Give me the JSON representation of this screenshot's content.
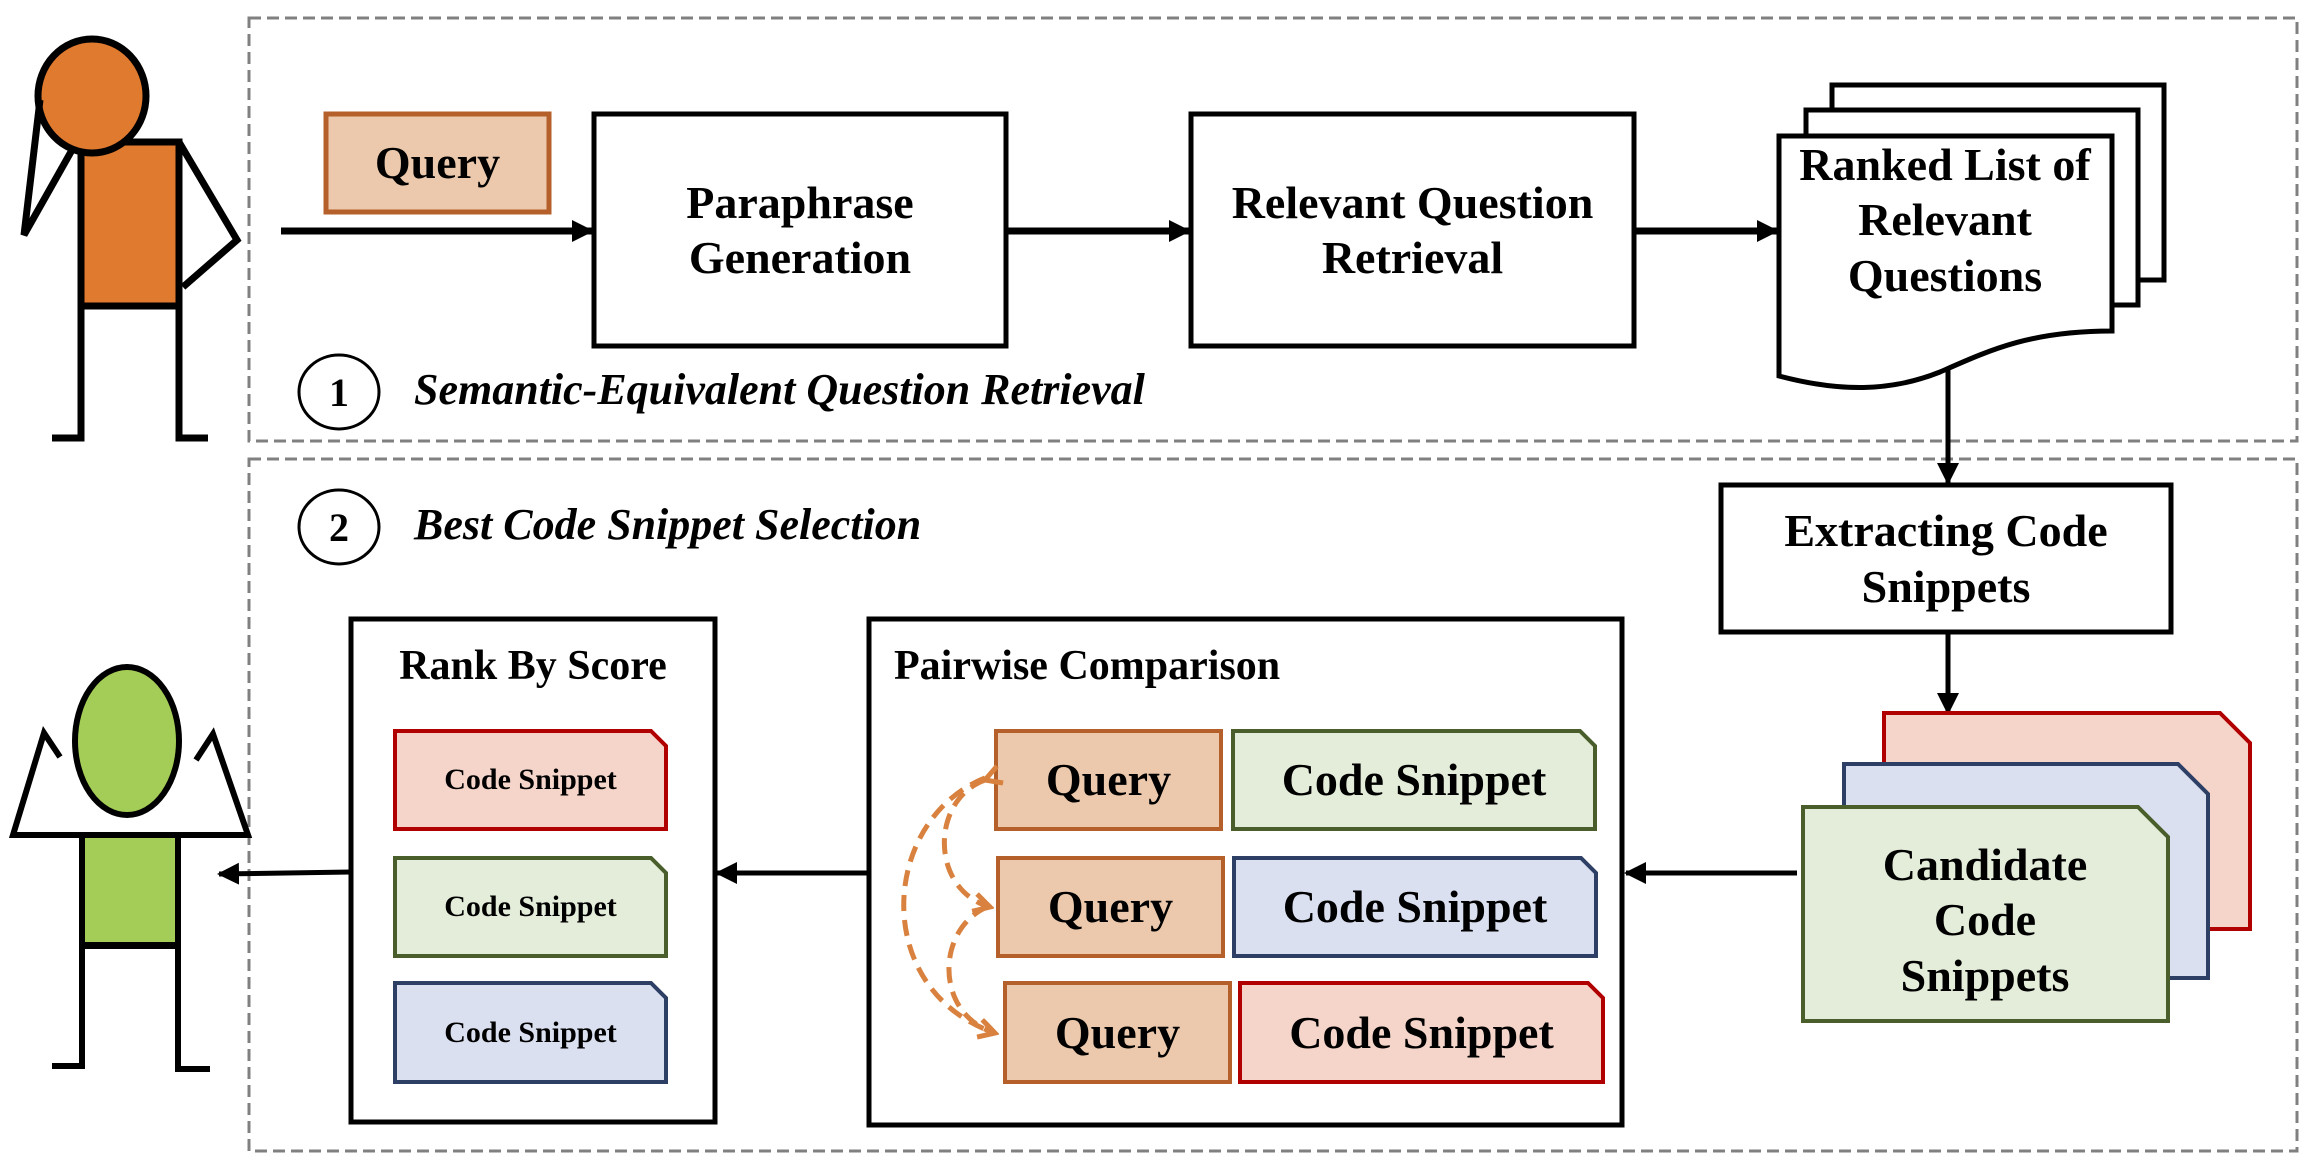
{
  "stages": {
    "stage1": {
      "number": "1",
      "title": "Semantic-Equivalent Question Retrieval"
    },
    "stage2": {
      "number": "2",
      "title": "Best Code Snippet Selection"
    }
  },
  "nodes": {
    "query": "Query",
    "paraphrase": "Paraphrase Generation",
    "relevant_retrieval": "Relevant Question Retrieval",
    "ranked_list": "Ranked List of Relevant Questions",
    "extracting": "Extracting Code Snippets",
    "candidates": "Candidate Code Snippets",
    "pairwise_title": "Pairwise Comparison",
    "rank_title": "Rank By Score"
  },
  "pairwise_rows": [
    {
      "query": "Query",
      "snippet": "Code Snippet",
      "color": "green"
    },
    {
      "query": "Query",
      "snippet": "Code Snippet",
      "color": "blue"
    },
    {
      "query": "Query",
      "snippet": "Code Snippet",
      "color": "red"
    }
  ],
  "ranked_items": [
    {
      "label": "Code Snippet",
      "color": "red"
    },
    {
      "label": "Code Snippet",
      "color": "green"
    },
    {
      "label": "Code Snippet",
      "color": "blue"
    }
  ],
  "colors": {
    "query_fill": "#ecc9ac",
    "query_stroke": "#b5602a",
    "person_orange": "#e07a2f",
    "person_green": "#a4cd57",
    "red_fill": "#f5d5ca",
    "red_stroke": "#b00000",
    "green_fill": "#e3edd9",
    "green_stroke": "#4a5e2c",
    "blue_fill": "#dae0f0",
    "blue_stroke": "#2e3f66",
    "dashed_border": "#808080",
    "arc": "#d9813e"
  }
}
